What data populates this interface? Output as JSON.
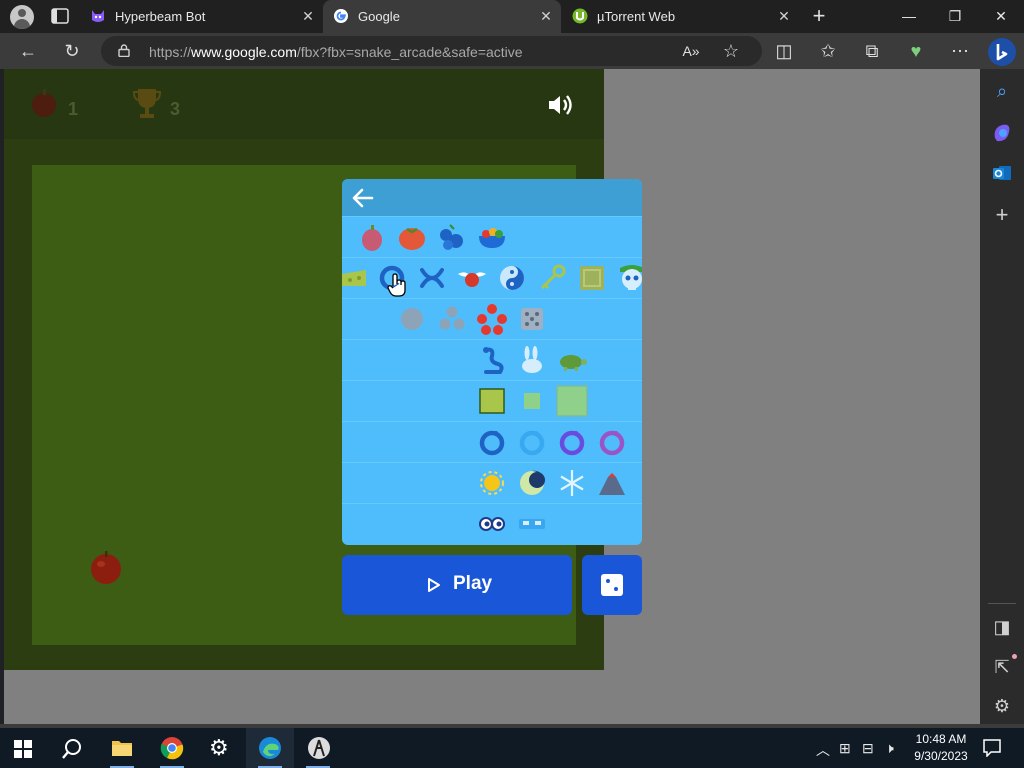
{
  "browser": {
    "tabs": [
      {
        "title": "Hyperbeam Bot",
        "icon": "hyperbeam-cat-icon",
        "active": false
      },
      {
        "title": "Google",
        "icon": "google-g-icon",
        "active": true
      },
      {
        "title": "µTorrent Web",
        "icon": "utorrent-icon",
        "active": false
      }
    ],
    "url_prefix": "https://",
    "url_domain": "www.google.com",
    "url_suffix": "/fbx?fbx=snake_arcade&safe=active"
  },
  "game": {
    "apple_score": "1",
    "trophy_score": "3",
    "colors": {
      "board": "#3d5c14",
      "frame": "#2b3d11",
      "panel": "#4fbdfb",
      "panel_header": "#3e9fd4",
      "play": "#1a56d8"
    }
  },
  "options_panel": {
    "rows": [
      [
        "fig-icon",
        "tomato-icon",
        "blueberries-icon",
        "salad-bowl-icon"
      ],
      [
        "cheese-icon",
        "ring-icon",
        "pretzel-icon",
        "winged-apple-icon",
        "yin-yang-icon",
        "key-icon",
        "crate-icon",
        "skull-icon"
      ],
      [
        "one-apple-icon",
        "three-apples-icon",
        "five-apples-icon",
        "dice-icon"
      ],
      [
        "snake-icon",
        "rabbit-icon",
        "turtle-icon"
      ],
      [
        "large-square-icon",
        "small-square-icon",
        "huge-square-icon"
      ],
      [
        "snake-ring-icon",
        "snake-ring-cyan-icon",
        "snake-ring-purple-icon",
        "snake-ring-violet-icon"
      ],
      [
        "sun-icon",
        "moon-icon",
        "snowflake-icon",
        "volcano-icon"
      ],
      [
        "eyes-icon",
        "visor-icon"
      ]
    ]
  },
  "buttons": {
    "play_label": "Play"
  },
  "taskbar": {
    "time": "10:48 AM",
    "date": "9/30/2023"
  }
}
